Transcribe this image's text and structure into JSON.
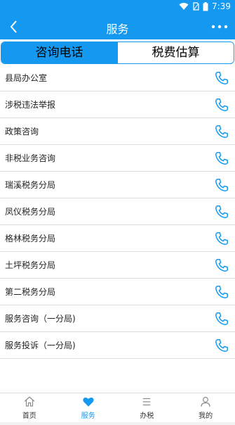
{
  "status_bar": {
    "time": "7:39"
  },
  "header": {
    "title": "服务"
  },
  "tabs": [
    {
      "label": "咨询电话",
      "active": true
    },
    {
      "label": "税费估算",
      "active": false
    }
  ],
  "contacts": [
    {
      "label": "县局办公室"
    },
    {
      "label": "涉税违法举报"
    },
    {
      "label": "政策咨询"
    },
    {
      "label": "非税业务咨询"
    },
    {
      "label": "瑞溪税务分局"
    },
    {
      "label": "凤仪税务分局"
    },
    {
      "label": "格林税务分局"
    },
    {
      "label": "土坪税务分局"
    },
    {
      "label": "第二税务分局"
    },
    {
      "label": "服务咨询（一分局)"
    },
    {
      "label": "服务投诉（一分局)"
    }
  ],
  "bottom_nav": [
    {
      "label": "首页",
      "icon": "home-icon",
      "active": false
    },
    {
      "label": "服务",
      "icon": "heart-icon",
      "active": true
    },
    {
      "label": "办税",
      "icon": "menu-icon",
      "active": false
    },
    {
      "label": "我的",
      "icon": "person-icon",
      "active": false
    }
  ],
  "colors": {
    "primary": "#1598f0",
    "divider": "#dcdcdc",
    "text": "#222222"
  }
}
